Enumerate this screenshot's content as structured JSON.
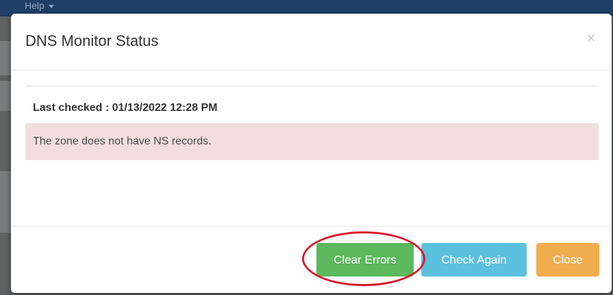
{
  "nav": {
    "help_label": "Help"
  },
  "modal": {
    "title": "DNS Monitor Status",
    "close_symbol": "×",
    "last_checked": "Last checked : 01/13/2022 12:28 PM",
    "alert_message": "The zone does not have NS records."
  },
  "footer": {
    "clear_errors_label": "Clear Errors",
    "check_again_label": "Check Again",
    "close_label": "Close"
  },
  "colors": {
    "nav_bg": "#1f3f66",
    "alert_bg": "#f1dedd",
    "success": "#5cb85c",
    "info": "#5bc0de",
    "warning": "#f0ad4e",
    "annotation_ring": "#d81a2c"
  },
  "icons": {
    "help_caret": "caret-down-icon",
    "modal_close": "close-icon"
  }
}
